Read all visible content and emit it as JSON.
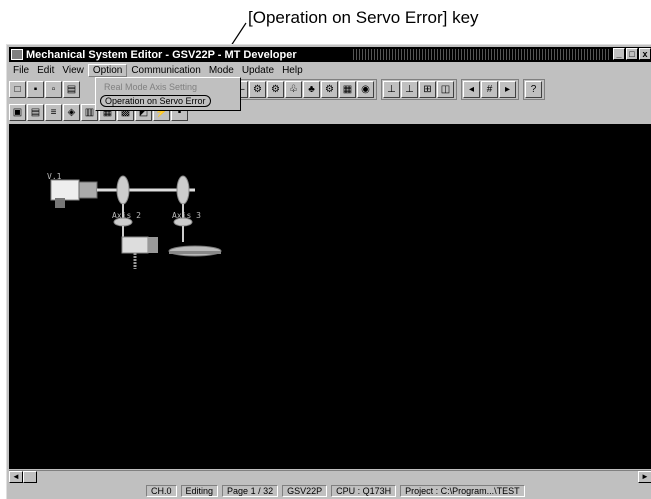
{
  "callout": {
    "label": "[Operation on Servo Error] key"
  },
  "window": {
    "title": "Mechanical System Editor - GSV22P - MT Developer",
    "controls": {
      "minimize": "_",
      "maximize": "□",
      "close": "x"
    }
  },
  "menu": {
    "items": [
      "File",
      "Edit",
      "View",
      "Option",
      "Communication",
      "Mode",
      "Update",
      "Help"
    ]
  },
  "option_menu": {
    "items": [
      "Real Mode Axis Setting",
      "Operation on Servo Error"
    ]
  },
  "canvas": {
    "axis_labels": [
      "V.1",
      "Axis 2",
      "Axis 3"
    ]
  },
  "status": {
    "channel": "CH.0",
    "mode": "Editing",
    "page": "Page 1 / 32",
    "project_type": "GSV22P",
    "cpu": "CPU : Q173H",
    "project": "Project : C:\\Program...\\TEST"
  },
  "scroll": {
    "left": "◄",
    "right": "►"
  },
  "colors": {
    "canvas_bg": "#000000",
    "chrome": "#c0c0c0",
    "title_bg": "#000000"
  }
}
